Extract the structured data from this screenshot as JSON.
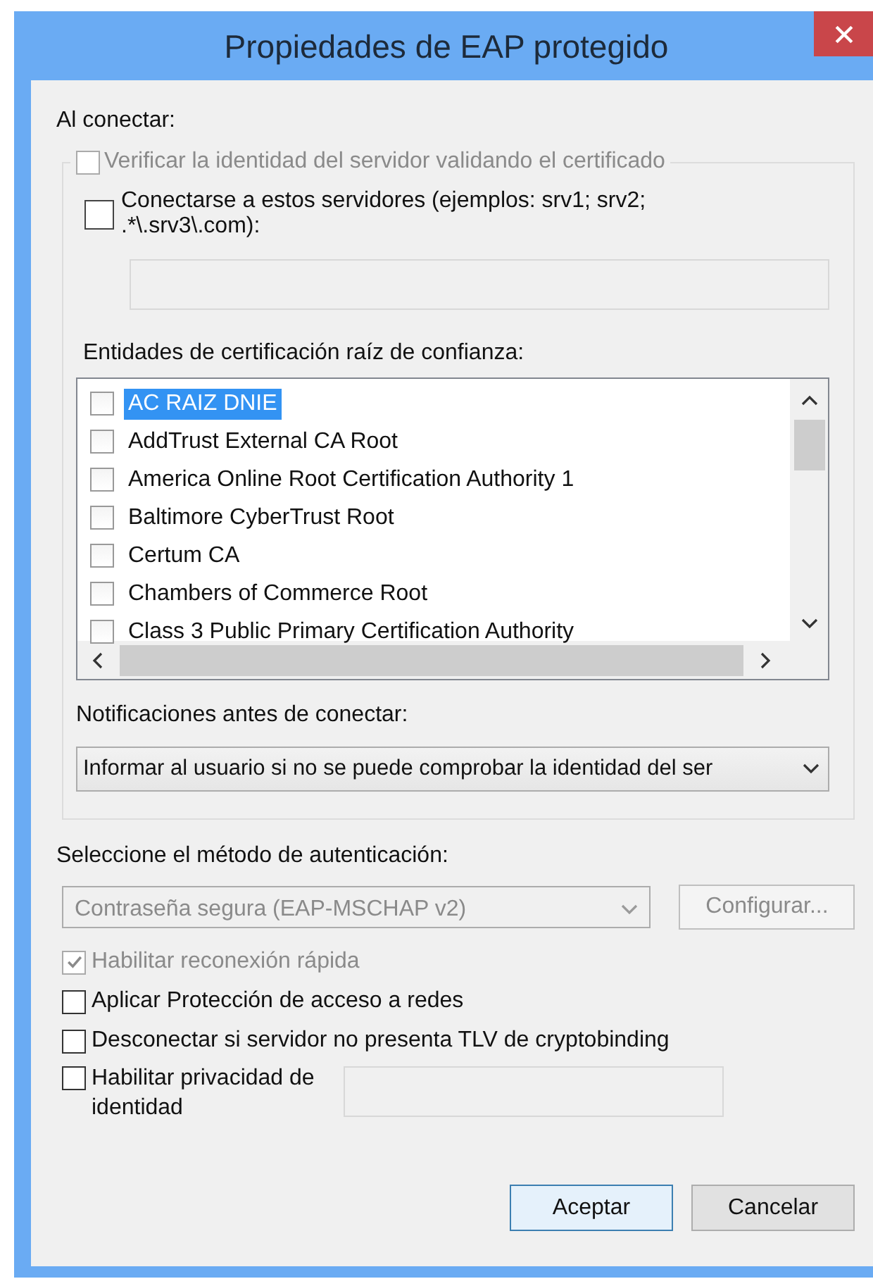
{
  "window": {
    "title": "Propiedades de EAP protegido"
  },
  "connect_label": "Al conectar:",
  "verify_server": {
    "label": "Verificar la identidad del servidor validando el certificado",
    "checked": false,
    "disabled": true
  },
  "connect_servers": {
    "label": "Conectarse a estos servidores (ejemplos: srv1; srv2; .*\\.srv3\\.com):",
    "checked": false
  },
  "ca_list": {
    "label": "Entidades de certificación raíz de confianza:",
    "items": [
      {
        "name": "AC RAIZ DNIE",
        "checked": false,
        "selected": true
      },
      {
        "name": "AddTrust External CA Root",
        "checked": false,
        "selected": false
      },
      {
        "name": "America Online Root Certification Authority 1",
        "checked": false,
        "selected": false
      },
      {
        "name": "Baltimore CyberTrust Root",
        "checked": false,
        "selected": false
      },
      {
        "name": "Certum CA",
        "checked": false,
        "selected": false
      },
      {
        "name": "Chambers of Commerce Root",
        "checked": false,
        "selected": false
      },
      {
        "name": "Class 3 Public Primary Certification Authority",
        "checked": false,
        "selected": false
      }
    ]
  },
  "notifications": {
    "label": "Notificaciones antes de conectar:",
    "value": "Informar al usuario si no se puede comprobar la identidad del ser"
  },
  "auth": {
    "label": "Seleccione el método de autenticación:",
    "method": {
      "value": "Contraseña segura (EAP-MSCHAP v2)",
      "disabled": true
    },
    "configure_button": {
      "label": "Configurar...",
      "disabled": true
    }
  },
  "options": [
    {
      "kind": "plain",
      "label": "Habilitar reconexión rápida",
      "checked": true,
      "disabled": true
    },
    {
      "kind": "plain",
      "label": "Aplicar Protección de acceso a redes",
      "checked": false,
      "disabled": false
    },
    {
      "kind": "plain",
      "label": "Desconectar si servidor no presenta TLV de cryptobinding",
      "checked": false,
      "disabled": false
    },
    {
      "kind": "with_field",
      "label": "Habilitar privacidad de identidad",
      "checked": false,
      "disabled": false
    }
  ],
  "buttons": [
    {
      "label": "Aceptar",
      "default": true
    },
    {
      "label": "Cancelar",
      "default": false
    }
  ]
}
